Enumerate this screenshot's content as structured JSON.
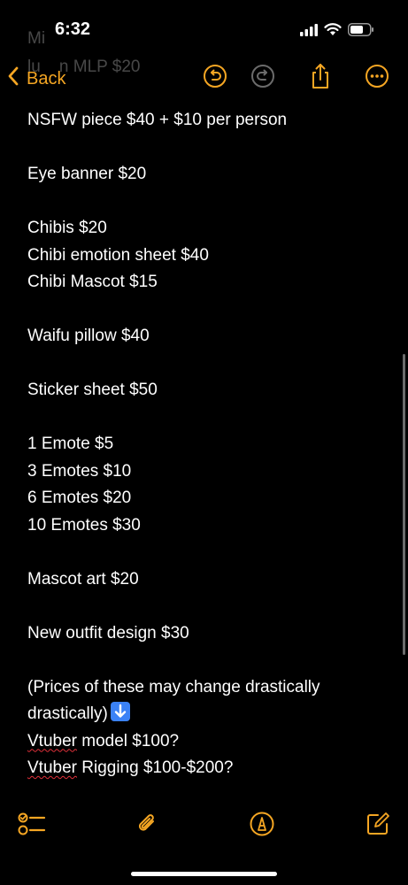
{
  "status": {
    "time": "6:32"
  },
  "nav": {
    "back_label": "Back",
    "faded_top": "Mi",
    "faded_mid": "lu    n MLP $20"
  },
  "note": {
    "lines": [
      "NSFW piece $40 + $10 per person",
      "",
      "Eye banner $20",
      "",
      "Chibis $20",
      "Chibi emotion sheet $40",
      "Chibi Mascot $15",
      "",
      "Waifu pillow $40",
      "",
      "Sticker sheet $50",
      "",
      "1 Emote $5",
      "3 Emotes $10",
      "6 Emotes $20",
      "10 Emotes $30",
      "",
      "Mascot art $20",
      "",
      "New outfit design $30",
      "",
      "(Prices of these may change drastically",
      "drastically)",
      "Vtuber",
      " model $100?",
      "Vtuber",
      " Rigging $100-$200?"
    ]
  },
  "colors": {
    "accent": "#f5a623",
    "background": "#000000",
    "spellcheck": "#e0303a"
  },
  "icons": {
    "back": "chevron-left-icon",
    "undo": "undo-icon",
    "redo": "redo-icon",
    "share": "share-icon",
    "more": "more-icon",
    "checklist": "checklist-icon",
    "attach": "paperclip-icon",
    "markup": "pen-icon",
    "compose": "compose-icon",
    "emoji": "down-arrow-emoji-icon"
  }
}
